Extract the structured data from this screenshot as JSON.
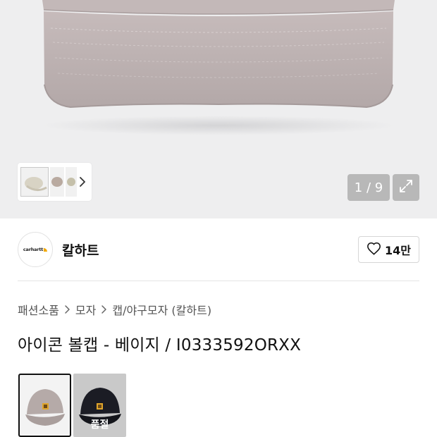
{
  "gallery": {
    "counter": "1 / 9",
    "thumbnails": [
      "thumbnail-1",
      "thumbnail-2",
      "thumbnail-3"
    ],
    "icons": {
      "next": "chevron-right-icon",
      "expand": "expand-icon"
    }
  },
  "brand": {
    "name": "칼하트",
    "logo_text": "carhartt"
  },
  "like": {
    "count": "14만",
    "icon": "heart-outline-icon"
  },
  "breadcrumb": [
    "패션소품",
    "모자",
    "캡/야구모자 (칼하트)"
  ],
  "product": {
    "title": "아이콘 볼캡 - 베이지 / I0333592ORXX"
  },
  "options": [
    {
      "color": "#b5aaa8",
      "selected": true,
      "label": ""
    },
    {
      "color": "#1b1c24",
      "selected": false,
      "label": "품절"
    }
  ],
  "colors": {
    "cap_beige": "#beb4b4",
    "hero_bg": "#eeeeef",
    "counter_bg": "#b8b8b8"
  }
}
